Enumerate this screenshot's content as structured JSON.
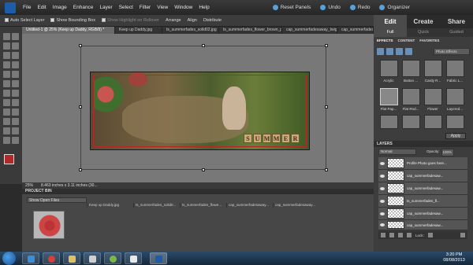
{
  "menu": [
    "File",
    "Edit",
    "Image",
    "Enhance",
    "Layer",
    "Select",
    "Filter",
    "View",
    "Window",
    "Help"
  ],
  "top_buttons": {
    "reset": "Reset Panels",
    "undo": "Undo",
    "redo": "Redo",
    "organizer": "Organizer"
  },
  "options": {
    "auto_select": "Auto Select Layer",
    "show_bounding": "Show Bounding Box",
    "show_highlight": "Show Highlight on Rollover",
    "arrange": "Arrange",
    "align": "Align",
    "distribute": "Distribute"
  },
  "doc_tabs": [
    "Untitled-1 @ 25% (Keep up Daddy, RGB/8) *",
    "Keep up Daddy.jpg",
    "ts_summerfades_solid02.jpg",
    "ts_summerfades_flower_brown_pink.png",
    "cap_summerfadesaway_twig.png",
    "cap_summerfadesaway_tags..."
  ],
  "canvas_text": {
    "summer": [
      "S",
      "U",
      "M",
      "M",
      "E",
      "R"
    ]
  },
  "status": {
    "zoom": "25%",
    "size": "8.463 inches x 3.11 inches (30..."
  },
  "project_bin": {
    "title": "PROJECT BIN",
    "selector": "Show Open Files",
    "files": [
      "Keep up Daddy.jpg",
      "ts_summerfades_solid0...",
      "ts_summerfades_flowe...",
      "cap_summerfadesaway...",
      "cap_summerfadesaway..."
    ]
  },
  "modes": {
    "edit": "Edit",
    "create": "Create",
    "share": "Share"
  },
  "subtabs": {
    "full": "Full",
    "quick": "Quick",
    "guided": "Guided"
  },
  "effects": {
    "tabs": [
      "EFFECTS",
      "CONTENT",
      "FAVORITES"
    ],
    "dropdown": "Photo Effects",
    "items": [
      "Acrylic",
      "Button ...",
      "Cardy R...",
      "Fabric L...",
      "Flat Pap...",
      "Flat Rnd...",
      "Flower",
      "Layered..."
    ],
    "apply": "Apply"
  },
  "layers": {
    "title": "LAYERS",
    "blend": "Normal",
    "opacity_label": "Opacity:",
    "opacity_value": "100%",
    "lock": "Lock:",
    "items": [
      "Profile Photo goes here...",
      "cap_summerfadesaw...",
      "cap_summerfadesaw...",
      "ts_summerfades_fl...",
      "cap_summerfadesaw...",
      "cap_summerfadesaw..."
    ]
  },
  "clock": {
    "time": "3:20 PM",
    "date": "08/08/2013"
  },
  "colors": {
    "accent": "#1b5da8",
    "frame_red": "#b02a2a"
  }
}
